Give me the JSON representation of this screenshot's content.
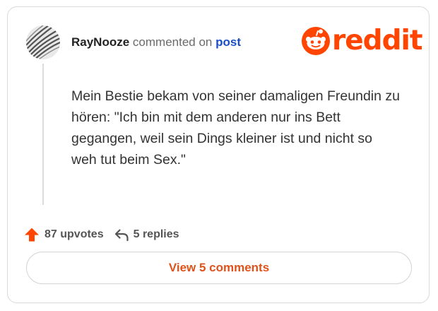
{
  "comment": {
    "username": "RayNooze",
    "commented_text": "commented on",
    "post_link_text": "post",
    "body": "Mein Bestie bekam von seiner damaligen Freundin zu hören: \"Ich bin mit dem anderen nur ins Bett gegangen, weil sein Dings kleiner ist und nicht so weh tut beim Sex.\"",
    "upvotes_text": "87 upvotes",
    "replies_text": "5 replies",
    "view_comments_label": "View 5 comments"
  },
  "brand": {
    "wordmark": "reddit",
    "color": "#ff4500"
  },
  "icons": {
    "avatar": "avatar",
    "logo": "reddit-snoo-icon",
    "upvote": "upvote-arrow-icon",
    "reply": "reply-arrow-icon"
  },
  "colors": {
    "username": "#222222",
    "post_link": "#1a4fc7",
    "view_button_text": "#e0521a",
    "upvote_icon": "#ff4500",
    "card_border": "#d9d9d9"
  }
}
